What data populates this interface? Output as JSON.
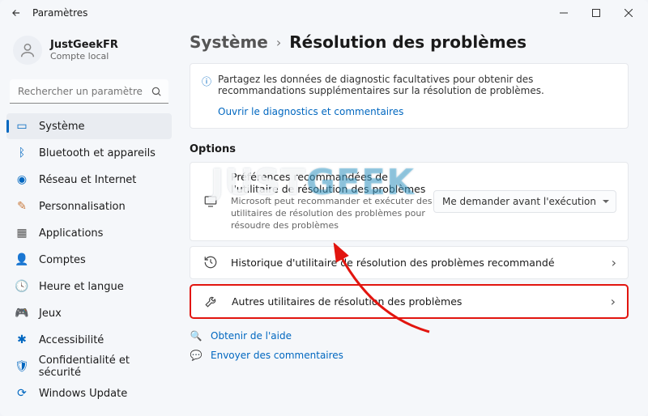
{
  "window": {
    "title": "Paramètres"
  },
  "account": {
    "name": "JustGeekFR",
    "subtitle": "Compte local"
  },
  "search": {
    "placeholder": "Rechercher un paramètre"
  },
  "sidebar": {
    "items": [
      {
        "label": "Système"
      },
      {
        "label": "Bluetooth et appareils"
      },
      {
        "label": "Réseau et Internet"
      },
      {
        "label": "Personnalisation"
      },
      {
        "label": "Applications"
      },
      {
        "label": "Comptes"
      },
      {
        "label": "Heure et langue"
      },
      {
        "label": "Jeux"
      },
      {
        "label": "Accessibilité"
      },
      {
        "label": "Confidentialité et sécurité"
      },
      {
        "label": "Windows Update"
      }
    ]
  },
  "breadcrumb": {
    "parent": "Système",
    "current": "Résolution des problèmes"
  },
  "info": {
    "text": "Partagez les données de diagnostic facultatives pour obtenir des recommandations supplémentaires sur la résolution de problèmes.",
    "link": "Ouvrir le diagnostics et commentaires"
  },
  "section": {
    "title": "Options"
  },
  "cards": {
    "pref": {
      "title": "Préférences recommandées de l'utilitaire de résolution des problèmes",
      "subtitle": "Microsoft peut recommander et exécuter des utilitaires de résolution des problèmes pour résoudre des problèmes",
      "dropdown": "Me demander avant l'exécution"
    },
    "history": {
      "title": "Historique d'utilitaire de résolution des problèmes recommandé"
    },
    "other": {
      "title": "Autres utilitaires de résolution des problèmes"
    }
  },
  "help": {
    "get": "Obtenir de l'aide",
    "feedback": "Envoyer des commentaires"
  },
  "watermark": {
    "part1": "JUST",
    "part2": "GEEK"
  }
}
